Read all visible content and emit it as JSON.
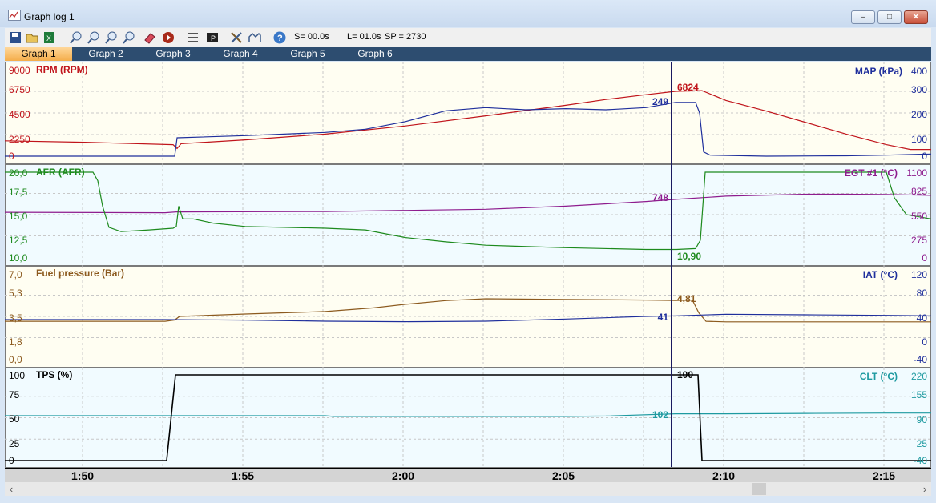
{
  "window": {
    "title": "Graph log 1",
    "controls": {
      "minimize": "–",
      "maximize": "□",
      "close": "✕"
    }
  },
  "toolbar": {
    "icons": [
      "save-icon",
      "open-icon",
      "excel-icon",
      "zoom-in-icon",
      "zoom-out-icon",
      "zoom-fit-icon",
      "zoom-x-icon",
      "eraser-icon",
      "record-icon",
      "list-icon",
      "parameters-icon",
      "tools-icon",
      "compare-icon",
      "help-icon"
    ],
    "selection": "S= 00.0s",
    "length": "L= 01.0s",
    "sample": "SP = 2730"
  },
  "tabs": [
    "Graph 1",
    "Graph 2",
    "Graph 3",
    "Graph 4",
    "Graph 5",
    "Graph 6"
  ],
  "active_tab": 0,
  "panels": [
    {
      "left": {
        "name": "RPM (RPM)",
        "ticks": [
          "9000",
          "6750",
          "4500",
          "2250",
          "0"
        ],
        "color": "#c0141b"
      },
      "right": {
        "name": "MAP (kPa)",
        "ticks": [
          "400",
          "300",
          "200",
          "100",
          "0"
        ],
        "color": "#1f2f9c"
      },
      "bg": "#fffef2",
      "cursor_values": {
        "left": "6824",
        "right": "249"
      }
    },
    {
      "left": {
        "name": "AFR (AFR)",
        "ticks": [
          "20,0",
          "17,5",
          "15,0",
          "12,5",
          "10,0"
        ],
        "color": "#1d8a1d"
      },
      "right": {
        "name": "EGT #1 (°C)",
        "ticks": [
          "1100",
          "825",
          "550",
          "275",
          "0"
        ],
        "color": "#8e1c8e"
      },
      "bg": "#f1fbff",
      "cursor_values": {
        "left": "10,90",
        "right": "748"
      }
    },
    {
      "left": {
        "name": "Fuel pressure (Bar)",
        "ticks": [
          "7,0",
          "5,3",
          "3,5",
          "1,8",
          "0,0"
        ],
        "color": "#8c5a1e"
      },
      "right": {
        "name": "IAT (°C)",
        "ticks": [
          "120",
          "80",
          "40",
          "0",
          "-40"
        ],
        "color": "#1f2f9c"
      },
      "bg": "#fffef2",
      "cursor_values": {
        "left": "4,81",
        "right": "41"
      }
    },
    {
      "left": {
        "name": "TPS (%)",
        "ticks": [
          "100",
          "75",
          "50",
          "25",
          "0"
        ],
        "color": "#000000"
      },
      "right": {
        "name": "CLT (°C)",
        "ticks": [
          "220",
          "155",
          "90",
          "25",
          "-40"
        ],
        "color": "#1e9aa0"
      },
      "bg": "#f1fbff",
      "cursor_values": {
        "left": "100",
        "right": "102"
      }
    }
  ],
  "time_axis": [
    "1:50",
    "1:55",
    "2:00",
    "2:05",
    "2:10",
    "2:15"
  ],
  "series": {
    "rpm": [
      [
        0,
        1600
      ],
      [
        100,
        1450
      ],
      [
        210,
        1200
      ],
      [
        215,
        800
      ],
      [
        220,
        1300
      ],
      [
        300,
        1700
      ],
      [
        400,
        2300
      ],
      [
        500,
        3150
      ],
      [
        600,
        4200
      ],
      [
        700,
        5300
      ],
      [
        750,
        5900
      ],
      [
        800,
        6400
      ],
      [
        837,
        6750
      ],
      [
        870,
        6824
      ],
      [
        900,
        5800
      ],
      [
        950,
        4700
      ],
      [
        1000,
        3500
      ],
      [
        1050,
        2300
      ],
      [
        1100,
        1200
      ],
      [
        1130,
        700
      ],
      [
        1156,
        700
      ]
    ],
    "map": [
      [
        0,
        0
      ],
      [
        200,
        0
      ],
      [
        212,
        0
      ],
      [
        215,
        85
      ],
      [
        300,
        95
      ],
      [
        400,
        110
      ],
      [
        450,
        125
      ],
      [
        500,
        160
      ],
      [
        550,
        210
      ],
      [
        600,
        225
      ],
      [
        650,
        215
      ],
      [
        700,
        220
      ],
      [
        750,
        215
      ],
      [
        800,
        225
      ],
      [
        837,
        249
      ],
      [
        862,
        249
      ],
      [
        867,
        200
      ],
      [
        872,
        20
      ],
      [
        880,
        5
      ],
      [
        950,
        0
      ],
      [
        1050,
        2
      ],
      [
        1100,
        5
      ],
      [
        1156,
        10
      ]
    ],
    "afr": [
      [
        0,
        20
      ],
      [
        110,
        20
      ],
      [
        116,
        19
      ],
      [
        122,
        16
      ],
      [
        130,
        13.5
      ],
      [
        145,
        13
      ],
      [
        180,
        13.2
      ],
      [
        210,
        13.4
      ],
      [
        214,
        13.6
      ],
      [
        217,
        16
      ],
      [
        222,
        14.5
      ],
      [
        235,
        14.5
      ],
      [
        260,
        14
      ],
      [
        300,
        13.6
      ],
      [
        400,
        13.4
      ],
      [
        450,
        13.2
      ],
      [
        500,
        12.3
      ],
      [
        550,
        11.8
      ],
      [
        600,
        11.4
      ],
      [
        700,
        11.1
      ],
      [
        800,
        10.9
      ],
      [
        838,
        10.9
      ],
      [
        862,
        11
      ],
      [
        868,
        12
      ],
      [
        874,
        20
      ],
      [
        1100,
        20
      ],
      [
        1110,
        17
      ],
      [
        1125,
        15
      ],
      [
        1156,
        14.5
      ]
    ],
    "egt": [
      [
        0,
        580
      ],
      [
        200,
        575
      ],
      [
        214,
        585
      ],
      [
        220,
        585
      ],
      [
        400,
        590
      ],
      [
        600,
        620
      ],
      [
        700,
        660
      ],
      [
        800,
        720
      ],
      [
        837,
        748
      ],
      [
        900,
        790
      ],
      [
        1000,
        815
      ],
      [
        1050,
        815
      ],
      [
        1100,
        810
      ],
      [
        1156,
        800
      ]
    ],
    "fuel": [
      [
        0,
        3.1
      ],
      [
        200,
        3.1
      ],
      [
        212,
        3.2
      ],
      [
        218,
        3.5
      ],
      [
        300,
        3.7
      ],
      [
        400,
        3.9
      ],
      [
        460,
        4.2
      ],
      [
        500,
        4.5
      ],
      [
        550,
        4.8
      ],
      [
        600,
        4.95
      ],
      [
        700,
        4.9
      ],
      [
        800,
        4.85
      ],
      [
        837,
        4.81
      ],
      [
        858,
        4.85
      ],
      [
        866,
        3.8
      ],
      [
        875,
        3.1
      ],
      [
        900,
        3.05
      ],
      [
        1156,
        3.05
      ]
    ],
    "iat": [
      [
        0,
        34
      ],
      [
        200,
        34
      ],
      [
        300,
        33
      ],
      [
        400,
        31
      ],
      [
        500,
        30
      ],
      [
        600,
        31
      ],
      [
        700,
        35
      ],
      [
        800,
        40
      ],
      [
        837,
        41
      ],
      [
        900,
        44
      ],
      [
        1000,
        43
      ],
      [
        1100,
        42
      ],
      [
        1156,
        41
      ]
    ],
    "tps": [
      [
        0,
        0
      ],
      [
        202,
        0
      ],
      [
        213,
        100
      ],
      [
        862,
        100
      ],
      [
        865,
        100
      ],
      [
        870,
        0
      ],
      [
        1156,
        0
      ]
    ],
    "clt": [
      [
        0,
        96
      ],
      [
        200,
        96
      ],
      [
        400,
        96
      ],
      [
        410,
        94
      ],
      [
        600,
        94
      ],
      [
        700,
        94
      ],
      [
        750,
        95
      ],
      [
        837,
        102
      ],
      [
        900,
        102
      ],
      [
        1000,
        103
      ],
      [
        1100,
        104
      ],
      [
        1156,
        104
      ]
    ]
  }
}
